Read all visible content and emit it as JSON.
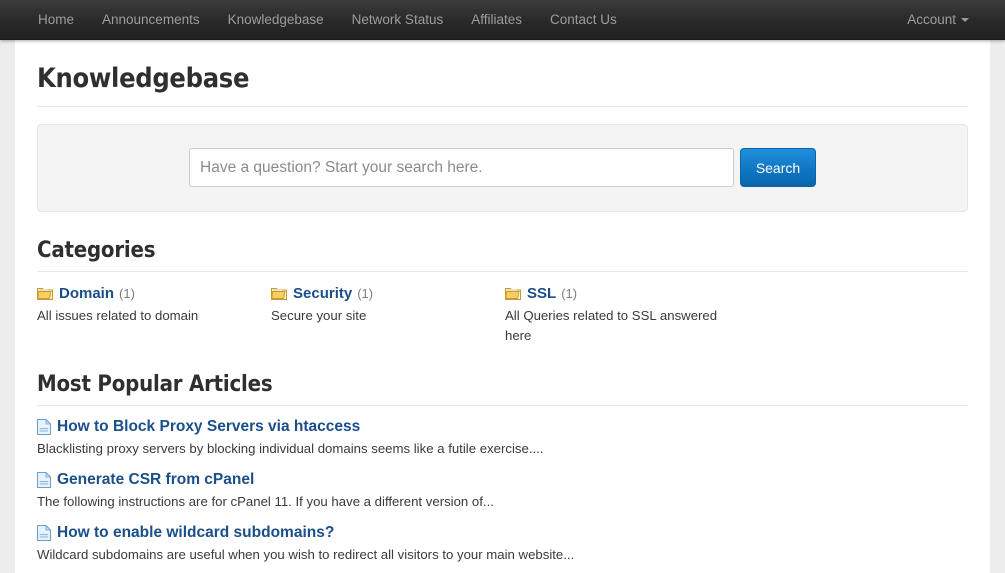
{
  "navbar": {
    "left_items": [
      {
        "label": "Home",
        "icon": ""
      },
      {
        "label": "Announcements",
        "icon": ""
      },
      {
        "label": "Knowledgebase",
        "icon": ""
      },
      {
        "label": "Network Status",
        "icon": ""
      },
      {
        "label": "Affiliates",
        "icon": ""
      },
      {
        "label": "Contact Us",
        "icon": ""
      }
    ],
    "right_items": [
      {
        "label": "Account",
        "icon": "caret-down-icon"
      }
    ]
  },
  "page": {
    "title": "Knowledgebase"
  },
  "search": {
    "placeholder": "Have a question? Start your search here.",
    "value": "",
    "button_label": "Search"
  },
  "categories": {
    "heading": "Categories",
    "items": [
      {
        "name": "Domain",
        "count": "(1)",
        "description": "All issues related to domain",
        "icon": "folder-icon"
      },
      {
        "name": "Security",
        "count": "(1)",
        "description": "Secure your site",
        "icon": "folder-icon"
      },
      {
        "name": "SSL",
        "count": "(1)",
        "description": "All Queries related to SSL answered here",
        "icon": "folder-icon"
      }
    ]
  },
  "articles": {
    "heading": "Most Popular Articles",
    "items": [
      {
        "title": "How to Block Proxy Servers via htaccess",
        "excerpt": "Blacklisting proxy servers by blocking individual domains seems like a futile exercise....",
        "icon": "document-icon"
      },
      {
        "title": "Generate CSR from cPanel",
        "excerpt": "The following instructions are for cPanel 11. If you have a different version of...",
        "icon": "document-icon"
      },
      {
        "title": "How to enable wildcard subdomains?",
        "excerpt": "Wildcard subdomains are useful when you wish to redirect all visitors to your main website...",
        "icon": "document-icon"
      }
    ]
  },
  "colors": {
    "navbar_bg": "#292929",
    "navbar_text": "#9d9d9d",
    "link_blue": "#1b4f8a",
    "button_blue": "#0e74c0",
    "page_bg": "#ededed",
    "container_bg": "#ffffff",
    "well_bg": "#f4f4f4",
    "folder_yellow": "#f2c14e",
    "doc_blue": "#c9ddf0"
  }
}
